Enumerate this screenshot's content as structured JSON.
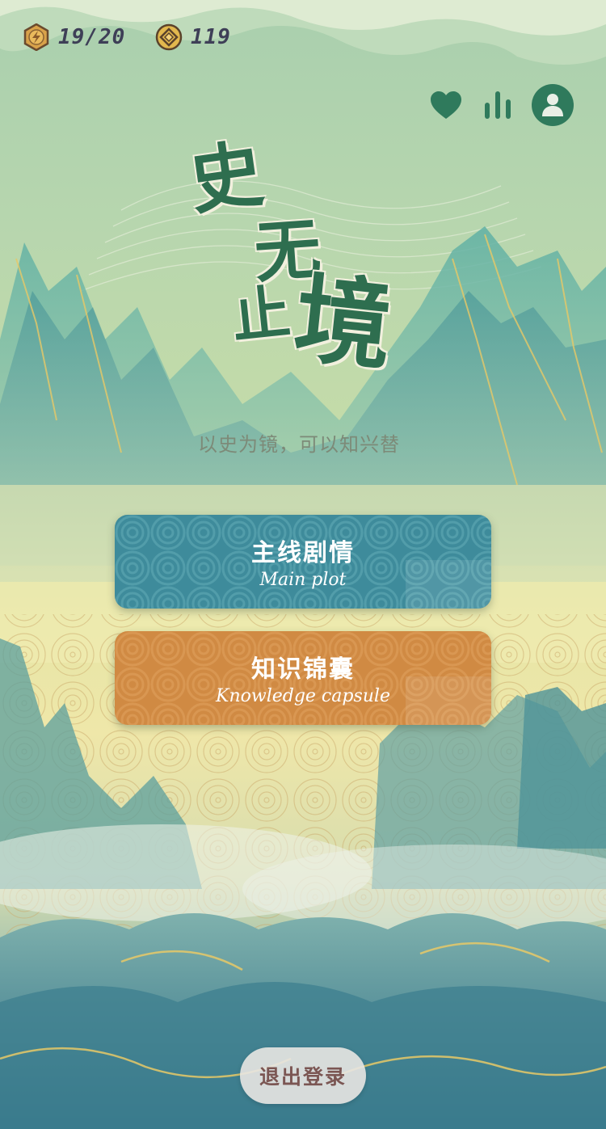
{
  "stats": {
    "energy": "19/20",
    "coins": "119"
  },
  "title": {
    "chars": [
      "史",
      "无",
      "止",
      "境"
    ]
  },
  "subtitle": "以史为镜，可以知兴替",
  "menu": {
    "main_plot": {
      "label_cn": "主线剧情",
      "label_en": "Main plot"
    },
    "knowledge": {
      "label_cn": "知识锦囊",
      "label_en": "Knowledge capsule"
    }
  },
  "logout_label": "退出登录",
  "icons": {
    "energy": "energy-badge-icon",
    "coin": "coin-icon",
    "favorites": "heart-icon",
    "ranking": "bar-chart-icon",
    "profile": "user-icon"
  },
  "colors": {
    "title_green": "#2e6e4f",
    "main_button": "#3e8b9b",
    "knowledge_button": "#d08a43",
    "logout_text": "#7b5653"
  }
}
